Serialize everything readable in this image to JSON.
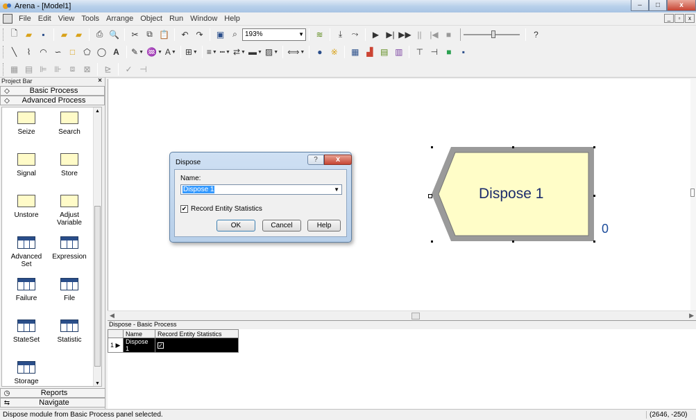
{
  "window": {
    "title": "Arena - [Model1]"
  },
  "menu": [
    "File",
    "Edit",
    "View",
    "Tools",
    "Arrange",
    "Object",
    "Run",
    "Window",
    "Help"
  ],
  "toolbar": {
    "zoom_value": "193%"
  },
  "project_bar": {
    "title": "Project Bar",
    "panels": {
      "basic": "Basic Process",
      "advanced": "Advanced Process",
      "reports": "Reports",
      "navigate": "Navigate"
    },
    "modules": [
      {
        "label": "Seize"
      },
      {
        "label": "Search"
      },
      {
        "label": "Signal"
      },
      {
        "label": "Store"
      },
      {
        "label": "Unstore"
      },
      {
        "label": "Adjust Variable"
      },
      {
        "label": "Advanced Set"
      },
      {
        "label": "Expression"
      },
      {
        "label": "Failure"
      },
      {
        "label": "File"
      },
      {
        "label": "StateSet"
      },
      {
        "label": "Statistic"
      },
      {
        "label": "Storage"
      }
    ]
  },
  "canvas": {
    "dispose_module": {
      "label": "Dispose 1",
      "count": "0",
      "fill_color": "#fffdc8"
    }
  },
  "dialog": {
    "title": "Dispose",
    "help_glyph": "?",
    "close_glyph": "x",
    "name_label": "Name:",
    "name_value": "Dispose 1",
    "checkbox_label": "Record Entity Statistics",
    "checkbox_checked": true,
    "ok": "OK",
    "cancel": "Cancel",
    "help": "Help"
  },
  "spreadsheet": {
    "title": "Dispose - Basic Process",
    "columns": [
      "Name",
      "Record Entity Statistics"
    ],
    "rows": [
      {
        "num": "1",
        "name": "Dispose 1",
        "record": true
      }
    ]
  },
  "status": {
    "message": "Dispose module from Basic Process panel selected.",
    "coords": "(2646, -250)"
  }
}
